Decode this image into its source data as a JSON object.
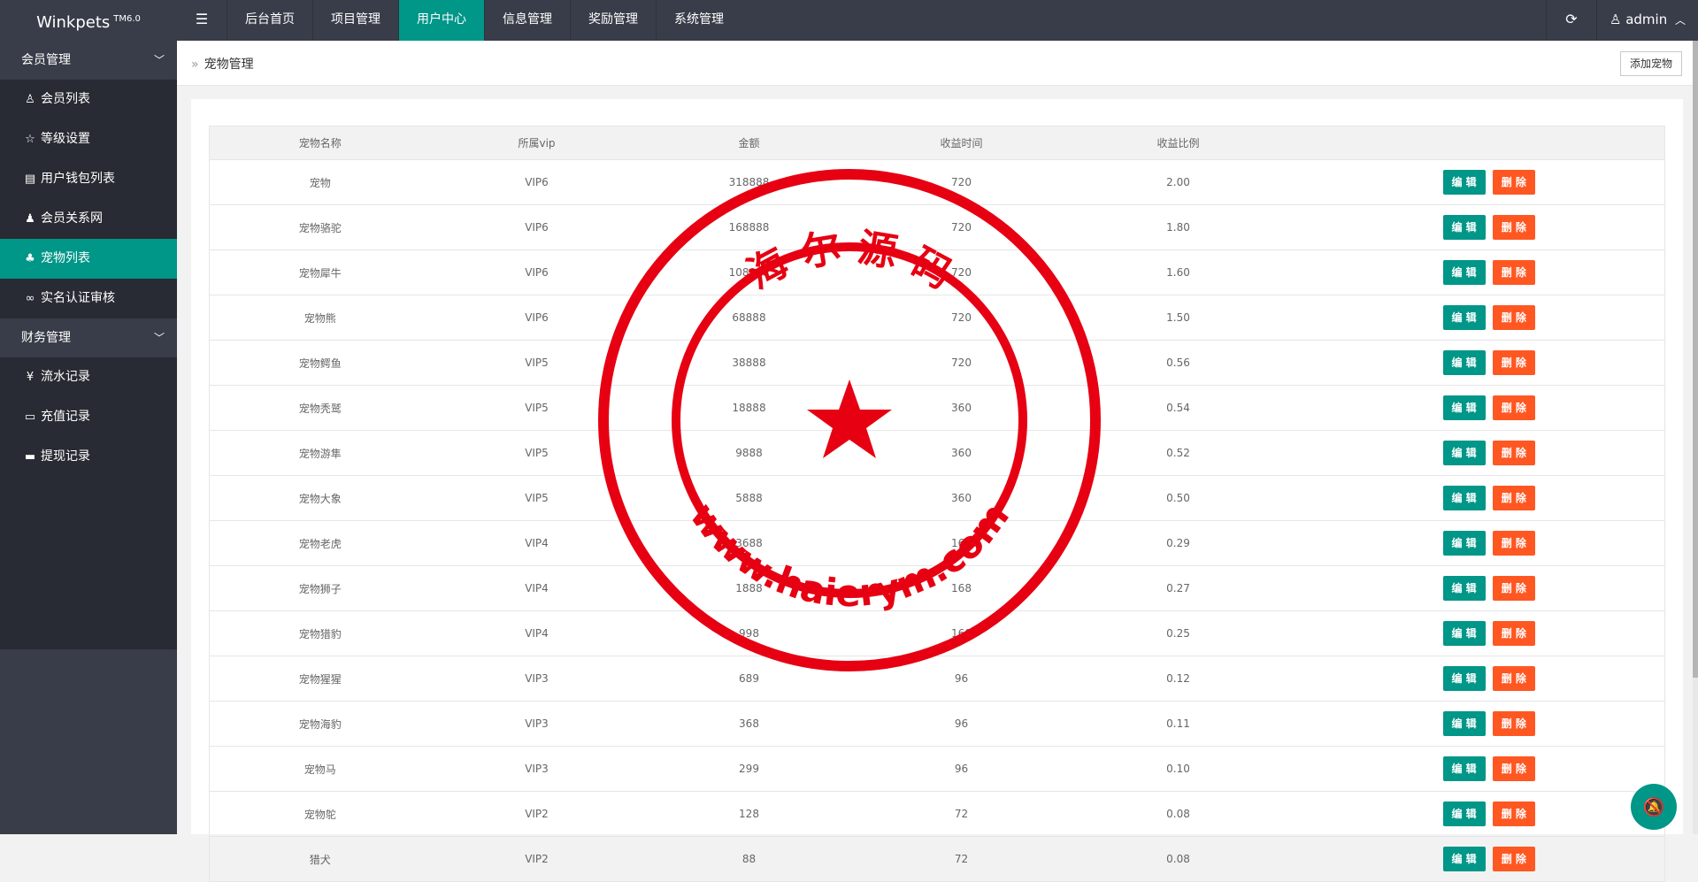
{
  "header": {
    "logo": "Winkpets",
    "logo_version": "TM6.0",
    "menu_icon": "menu-icon",
    "nav": [
      "后台首页",
      "项目管理",
      "用户中心",
      "信息管理",
      "奖励管理",
      "系统管理"
    ],
    "active_nav": "用户中心",
    "user": "admin",
    "accent": "#009688",
    "bar_color": "#393d49"
  },
  "sidebar": {
    "groups": [
      {
        "title": "会员管理",
        "items": [
          {
            "label": "会员列表",
            "icon": "user-icon"
          },
          {
            "label": "等级设置",
            "icon": "star-icon"
          },
          {
            "label": "用户钱包列表",
            "icon": "card-icon"
          },
          {
            "label": "会员关系网",
            "icon": "users-icon"
          },
          {
            "label": "宠物列表",
            "icon": "pet-icon"
          },
          {
            "label": "实名认证审核",
            "icon": "link-icon"
          }
        ]
      },
      {
        "title": "财务管理",
        "items": [
          {
            "label": "流水记录",
            "icon": "yen-icon"
          },
          {
            "label": "充值记录",
            "icon": "bank-card-icon"
          },
          {
            "label": "提现记录",
            "icon": "credit-card-icon"
          }
        ]
      }
    ],
    "active_item": "宠物列表"
  },
  "page": {
    "breadcrumb": "宠物管理",
    "add_button": "添加宠物"
  },
  "table": {
    "columns": [
      "宠物名称",
      "所属vip",
      "金额",
      "收益时间",
      "收益比例",
      ""
    ],
    "edit_label": "编 辑",
    "delete_label": "删 除",
    "rows": [
      [
        "宠物",
        "VIP6",
        "318888",
        "720",
        "2.00"
      ],
      [
        "宠物骆驼",
        "VIP6",
        "168888",
        "720",
        "1.80"
      ],
      [
        "宠物犀牛",
        "VIP6",
        "108888",
        "720",
        "1.60"
      ],
      [
        "宠物熊",
        "VIP6",
        "68888",
        "720",
        "1.50"
      ],
      [
        "宠物鳄鱼",
        "VIP5",
        "38888",
        "720",
        "0.56"
      ],
      [
        "宠物秃鹫",
        "VIP5",
        "18888",
        "360",
        "0.54"
      ],
      [
        "宠物游隼",
        "VIP5",
        "9888",
        "360",
        "0.52"
      ],
      [
        "宠物大象",
        "VIP5",
        "5888",
        "360",
        "0.50"
      ],
      [
        "宠物老虎",
        "VIP4",
        "3688",
        "168",
        "0.29"
      ],
      [
        "宠物狮子",
        "VIP4",
        "1888",
        "168",
        "0.27"
      ],
      [
        "宠物猎豹",
        "VIP4",
        "998",
        "168",
        "0.25"
      ],
      [
        "宠物猩猩",
        "VIP3",
        "689",
        "96",
        "0.12"
      ],
      [
        "宠物海豹",
        "VIP3",
        "368",
        "96",
        "0.11"
      ],
      [
        "宠物马",
        "VIP3",
        "299",
        "96",
        "0.10"
      ],
      [
        "宠物鸵",
        "VIP2",
        "128",
        "72",
        "0.08"
      ],
      [
        "猎犬",
        "VIP2",
        "88",
        "72",
        "0.08"
      ]
    ]
  },
  "watermark": {
    "top_text": "海 尔 源 码",
    "bottom_text": "www.haierym.com",
    "color": "#e60012"
  }
}
